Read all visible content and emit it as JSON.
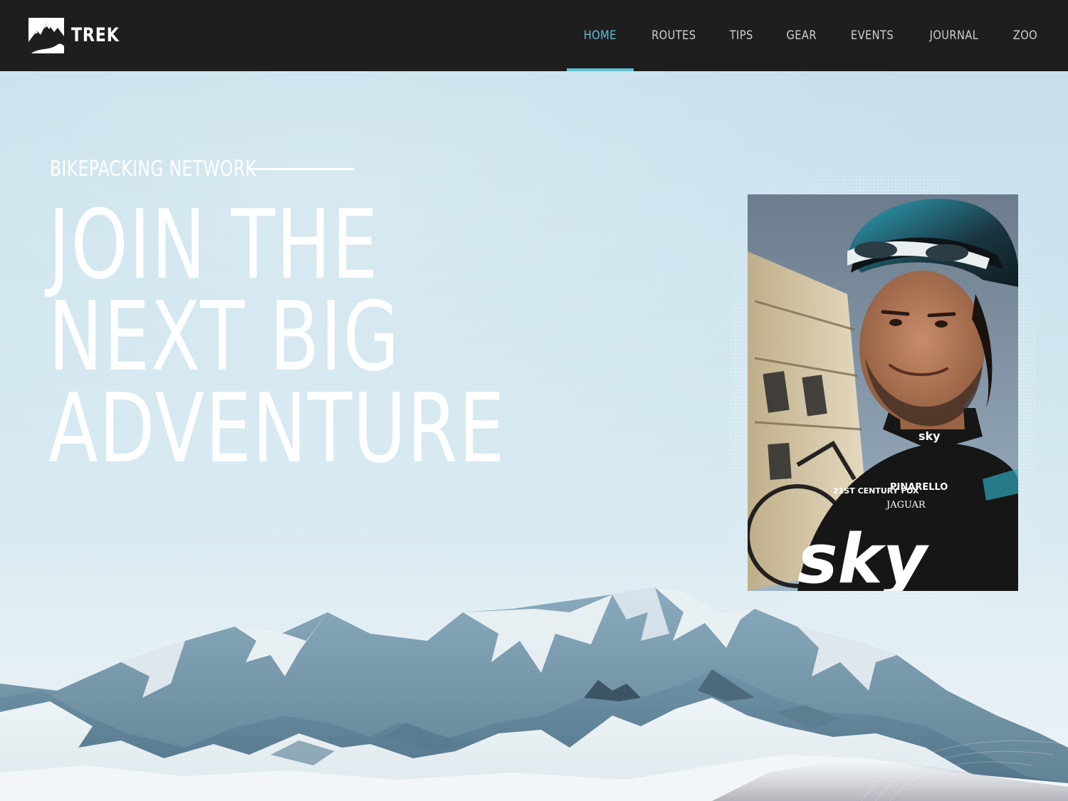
{
  "brand": {
    "name": "TREK",
    "logo_icon": "mountain-logo-icon"
  },
  "nav": {
    "items": [
      {
        "label": "HOME",
        "active": true
      },
      {
        "label": "ROUTES",
        "active": false
      },
      {
        "label": "TIPS",
        "active": false
      },
      {
        "label": "GEAR",
        "active": false
      },
      {
        "label": "EVENTS",
        "active": false
      },
      {
        "label": "JOURNAL",
        "active": false
      },
      {
        "label": "ZOO",
        "active": false
      }
    ]
  },
  "hero": {
    "eyebrow": "BIKEPACKING NETWORK",
    "headline": [
      "JOIN THE",
      "NEXT BIG",
      "ADVENTURE"
    ],
    "photo": {
      "jersey_brand": "sky",
      "sponsors": [
        "21ST CENTURY FOX",
        "PINARELLO",
        "JAGUAR"
      ]
    }
  },
  "colors": {
    "header_bg": "#1e1e1f",
    "accent": "#5ec0d3",
    "nav_text": "#d0d0d0",
    "hero_text": "#ffffff"
  }
}
